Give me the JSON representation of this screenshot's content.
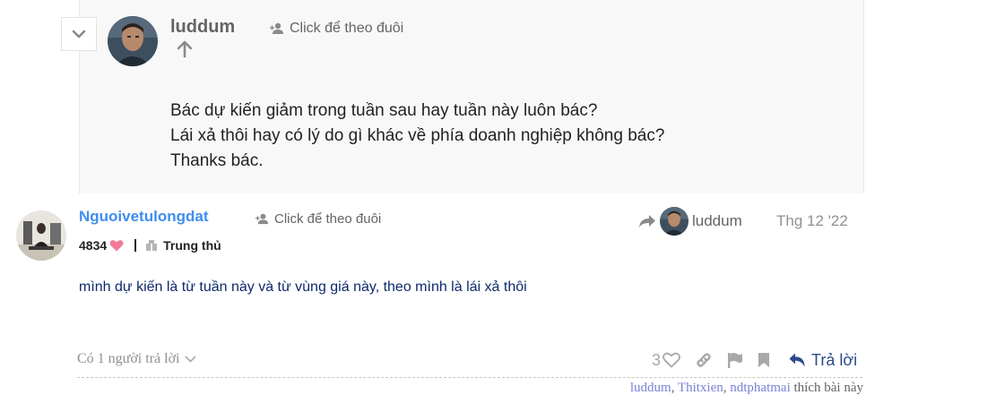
{
  "quote": {
    "username": "luddum",
    "follow_label": "Click để theo đuôi",
    "body_lines": [
      "Bác dự kiến giảm trong tuần sau hay tuần này luôn bác?",
      "Lái xả thôi hay có lý do gì khác về phía doanh nghiệp không bác?",
      "Thanks bác."
    ]
  },
  "post": {
    "username": "Nguoivetulongdat",
    "follow_label": "Click để theo đuôi",
    "likes_received": "4834",
    "user_title": "Trung thủ",
    "reply_to_user": "luddum",
    "date": "Thg 12 '22",
    "body": "mình dự kiến là từ tuần này và từ vùng giá này, theo mình là lái xả thôi"
  },
  "controls": {
    "replies_label": "Có 1 người trả lời",
    "like_count": "3",
    "reply_label": "Trả lời"
  },
  "likers": {
    "users": [
      "luddum",
      "Thitxien",
      "ndtphatmai"
    ],
    "suffix": "thích bài này"
  },
  "colors": {
    "username_link": "#3e8ef0",
    "body_text": "#0e2a6b",
    "reply_button": "#2b4a8a",
    "likers_link": "#7b7fd8",
    "heart": "#f27a98"
  },
  "icons": {
    "collapse": "chevron-down-icon",
    "follow": "user-plus-icon",
    "up_arrow": "arrow-up-icon",
    "heart": "heart-icon",
    "title_badge": "book-icon",
    "reply_to": "share-arrow-icon",
    "like": "heart-outline-icon",
    "link": "link-icon",
    "flag": "flag-icon",
    "bookmark": "bookmark-icon",
    "reply": "reply-icon"
  }
}
